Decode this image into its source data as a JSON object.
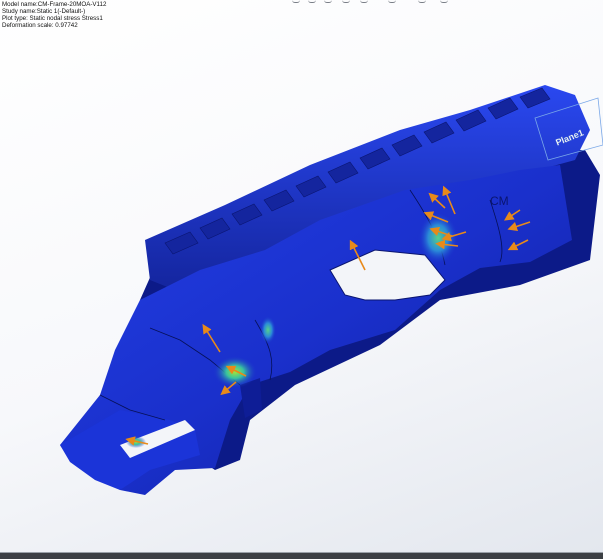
{
  "info": {
    "model_name": "Model name:CM-Frame-20MOA-V112",
    "study_name": "Study name:Static 1(-Default-)",
    "plot_type": "Plot type: Static nodal stress Stress1",
    "deformation_scale": "Deformation scale: 0.97742"
  },
  "model": {
    "plane_label": "Plane1",
    "logo_text": "CM"
  },
  "colors": {
    "background": "#ffffff",
    "part_base": "#1a2fd0",
    "part_dark": "#0a1880",
    "stress_high": "#7dd23a",
    "force_arrow": "#e88a1a"
  },
  "toolbar": {
    "icons": [
      "view-orientation-icon",
      "display-style-icon",
      "section-view-icon",
      "appearance-icon",
      "scene-icon",
      "view-settings-icon",
      "screen-capture-icon",
      "monitor-icon"
    ]
  }
}
